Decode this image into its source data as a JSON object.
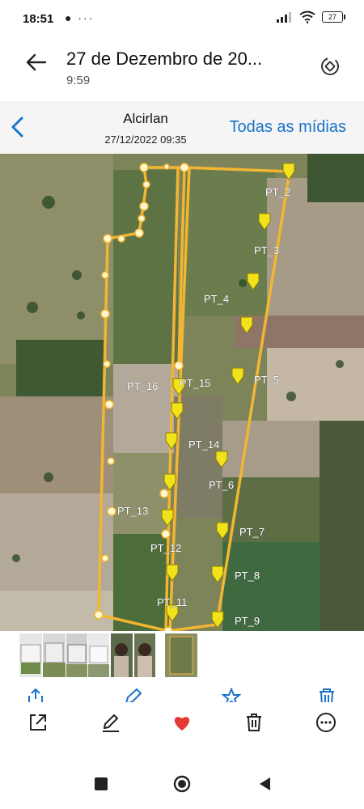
{
  "status_bar": {
    "time": "18:51",
    "notif_icons": "● ···",
    "battery": "27"
  },
  "header": {
    "title": "27 de Dezembro de 20...",
    "subtitle": "9:59"
  },
  "viewer": {
    "author": "Alcirlan",
    "datetime": "27/12/2022 09:35",
    "all_media": "Todas as mídias"
  },
  "map": {
    "point_labels": [
      {
        "key": "pt2",
        "text": "PT_2"
      },
      {
        "key": "pt3",
        "text": "PT_3"
      },
      {
        "key": "pt4",
        "text": "PT_4"
      },
      {
        "key": "pt5",
        "text": "PT_5"
      },
      {
        "key": "pt6",
        "text": "PT_6"
      },
      {
        "key": "pt7",
        "text": "PT_7"
      },
      {
        "key": "pt8",
        "text": "PT_8"
      },
      {
        "key": "pt9",
        "text": "PT_9"
      },
      {
        "key": "pt11",
        "text": "PT_11"
      },
      {
        "key": "pt12",
        "text": "PT_12"
      },
      {
        "key": "pt13",
        "text": "PT_13"
      },
      {
        "key": "pt14",
        "text": "PT_14"
      },
      {
        "key": "pt15",
        "text": "PT_15"
      },
      {
        "key": "pt16",
        "text": "PT_16"
      }
    ]
  },
  "icons": {
    "back": "arrow-left-icon",
    "rotate": "rotate-screen-icon",
    "share": "share-icon",
    "edit": "pencil-icon",
    "favorite": "heart-icon",
    "delete": "trash-icon",
    "more": "more-horizontal-icon"
  },
  "colors": {
    "accent": "#1a73c8",
    "heart": "#e53935",
    "polygon": "#f2b632",
    "pin": "#f2e21a"
  }
}
